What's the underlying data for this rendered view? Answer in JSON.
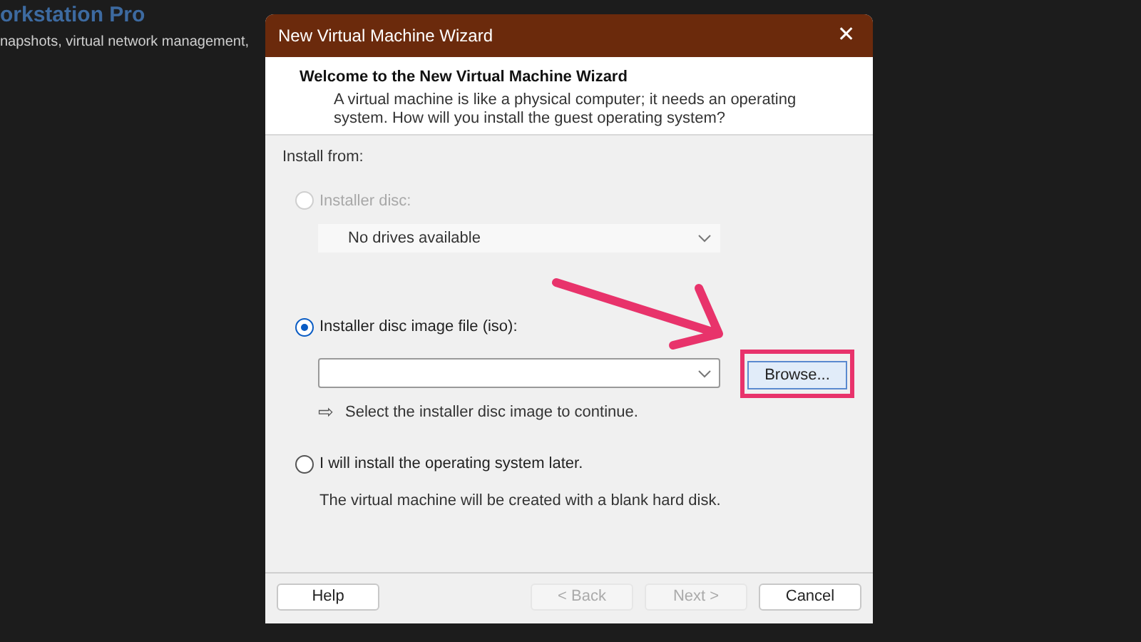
{
  "background": {
    "heading": "orkstation Pro",
    "text": "napshots, virtual network management,"
  },
  "window": {
    "title": "New Virtual Machine Wizard",
    "close": "✕"
  },
  "header": {
    "title": "Welcome to the New Virtual Machine Wizard",
    "description": "A virtual machine is like a physical computer; it needs an operating system. How will you install the guest operating system?"
  },
  "install_from": {
    "label": "Install from:",
    "options": [
      {
        "kind": "disc",
        "label": "Installer disc:",
        "selected": false,
        "disabled": true,
        "dropdown": "No drives available"
      },
      {
        "kind": "iso",
        "label": "Installer disc image file (iso):",
        "selected": true,
        "disabled": false,
        "browse": "Browse...",
        "hint_icon": "⇨",
        "hint": "Select the installer disc image to continue.",
        "highlighted": true
      },
      {
        "kind": "later",
        "label": "I will install the operating system later.",
        "selected": false,
        "disabled": false,
        "note": "The virtual machine will be created with a blank hard disk."
      }
    ]
  },
  "buttons": [
    {
      "label": "Help",
      "disabled": false
    },
    {
      "label": "< Back",
      "disabled": true
    },
    {
      "label": "Next >",
      "disabled": true
    },
    {
      "label": "Cancel",
      "disabled": false
    }
  ]
}
